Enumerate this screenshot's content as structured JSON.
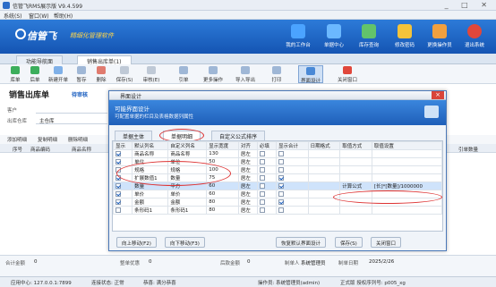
{
  "app": {
    "title": "信管飞RMS展示版 V9.4.599"
  },
  "menu": [
    "系统(S)",
    "窗口(W)",
    "帮助(H)"
  ],
  "brand": {
    "name": "信管飞",
    "slogan": "精细化管理软件"
  },
  "top_buttons": [
    "我的工作台",
    "单据中心",
    "库存查询",
    "修改密码",
    "更换操作员",
    "退出系统"
  ],
  "tabs": [
    "功能导航面",
    "销售出库单(1)"
  ],
  "toolbar": [
    "库单",
    "后单",
    "新建开单",
    "暂存",
    "删除",
    "保存(S)",
    "审核(E)",
    "引单",
    "更多操作",
    "导入导出",
    "打印",
    "界面设计",
    "关闭窗口"
  ],
  "bill": {
    "title": "销售出库单",
    "status": "待审核",
    "customer_label": "客户",
    "warehouse_label": "出库仓库",
    "warehouse_value": "主仓库"
  },
  "row_ops": [
    "添加明细",
    "复制明细",
    "删除明细"
  ],
  "grid_headers": [
    "序号",
    "商品编码",
    "商品名称",
    "引单数量"
  ],
  "footer": {
    "total_amount_label": "合计金额",
    "total_amount_value": "0",
    "discount_label": "整单优惠",
    "discount_value": "0",
    "after_label": "后款金额",
    "after_value": "0",
    "creator_label": "制单人",
    "creator_value": "系统管理员",
    "date_label": "制单日期",
    "date_value": "2025/2/26"
  },
  "status_bar": {
    "center": "应用中心: 127.0.0.1:7899",
    "conn": "连接状态: 正常",
    "user_tip": "恭喜: 满分恭喜",
    "operator": "操作员: 系统管理员(admin)",
    "version": "正式版 授权序列号: p005_xg"
  },
  "dialog": {
    "title": "界面设计",
    "header_title": "可能界面设计",
    "header_sub": "可配置单据的栏目及表格数据列属性",
    "tabs": [
      "单据主体",
      "单据明细",
      "自定义公式排序"
    ],
    "columns": [
      "显示",
      "默认列名",
      "自定义列名",
      "显示宽度",
      "对齐",
      "必填",
      "显示合计",
      "日期格式",
      "取值方式",
      "取值设置"
    ],
    "rows": [
      {
        "show": true,
        "default": "商品名称",
        "custom": "商品名称",
        "width": "130",
        "align": "居左",
        "required": false,
        "total": false,
        "mode": "",
        "setting": ""
      },
      {
        "show": true,
        "default": "单位",
        "custom": "单位",
        "width": "50",
        "align": "居左",
        "required": false,
        "total": false,
        "mode": "",
        "setting": ""
      },
      {
        "show": false,
        "default": "规格",
        "custom": "规格",
        "width": "100",
        "align": "居左",
        "required": false,
        "total": false,
        "mode": "",
        "setting": ""
      },
      {
        "show": true,
        "default": "扩展数值1",
        "custom": "数量",
        "width": "75",
        "align": "居左",
        "required": false,
        "total": true,
        "mode": "",
        "setting": ""
      },
      {
        "show": true,
        "default": "数量",
        "custom": "平方",
        "width": "60",
        "align": "居左",
        "required": false,
        "total": true,
        "mode": "计算公式",
        "setting": "[长]*[数量]/1000000"
      },
      {
        "show": true,
        "default": "单价",
        "custom": "单价",
        "width": "60",
        "align": "居左",
        "required": false,
        "total": false,
        "mode": "",
        "setting": ""
      },
      {
        "show": true,
        "default": "金额",
        "custom": "金额",
        "width": "80",
        "align": "居左",
        "required": false,
        "total": true,
        "mode": "",
        "setting": ""
      },
      {
        "show": false,
        "default": "条形码1",
        "custom": "条形码1",
        "width": "80",
        "align": "居左",
        "required": false,
        "total": false,
        "mode": "",
        "setting": ""
      }
    ],
    "buttons": {
      "up": "向上移动(F2)",
      "down": "向下移动(F3)",
      "restore": "恢复默认界面设计",
      "save": "保存(S)",
      "close": "关闭窗口"
    }
  },
  "colors": {
    "banner": "#1f5fb9",
    "accent": "#1b5fc0",
    "annotation": "#dd3333"
  }
}
